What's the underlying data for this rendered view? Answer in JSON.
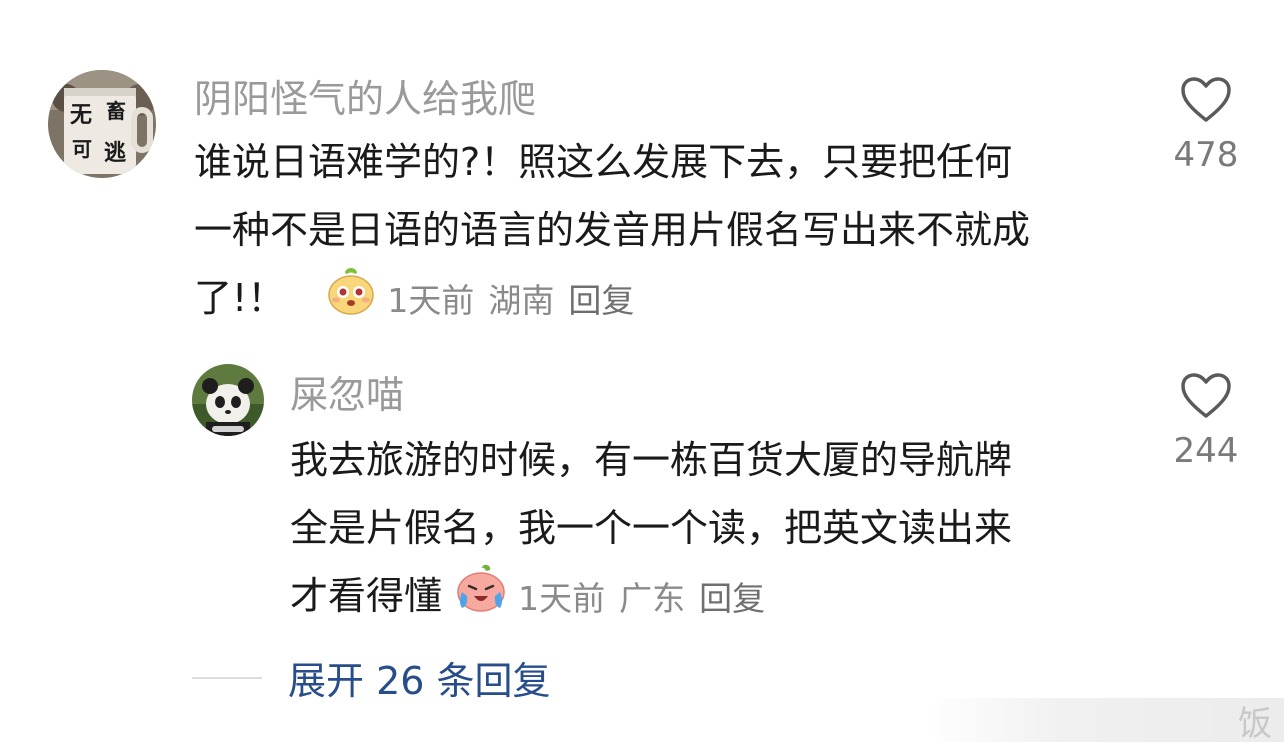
{
  "comment": {
    "username": "阴阳怪气的人给我爬",
    "text_lines": [
      "谁说日语难学的?！照这么发展下去，只要把任何",
      "一种不是日语的语言的发音用片假名写出来不就成",
      "了!！"
    ],
    "time": "1天前",
    "location": "湖南",
    "reply_label": "回复",
    "like_count": "478",
    "avatar_text": [
      "无",
      "畜",
      "可",
      "逃"
    ]
  },
  "reply": {
    "username": "屎忽喵",
    "text_lines": [
      "我去旅游的时候，有一栋百货大厦的导航牌",
      "全是片假名，我一个一个读，把英文读出来",
      "才看得懂"
    ],
    "time": "1天前",
    "location": "广东",
    "reply_label": "回复",
    "like_count": "244"
  },
  "expand_replies_label": "展开 26 条回复",
  "watermark_text": "饭",
  "icons": {
    "like": "heart-outline-icon",
    "emoji_1": "pear-face-emoji",
    "emoji_2": "crying-peach-emoji"
  }
}
